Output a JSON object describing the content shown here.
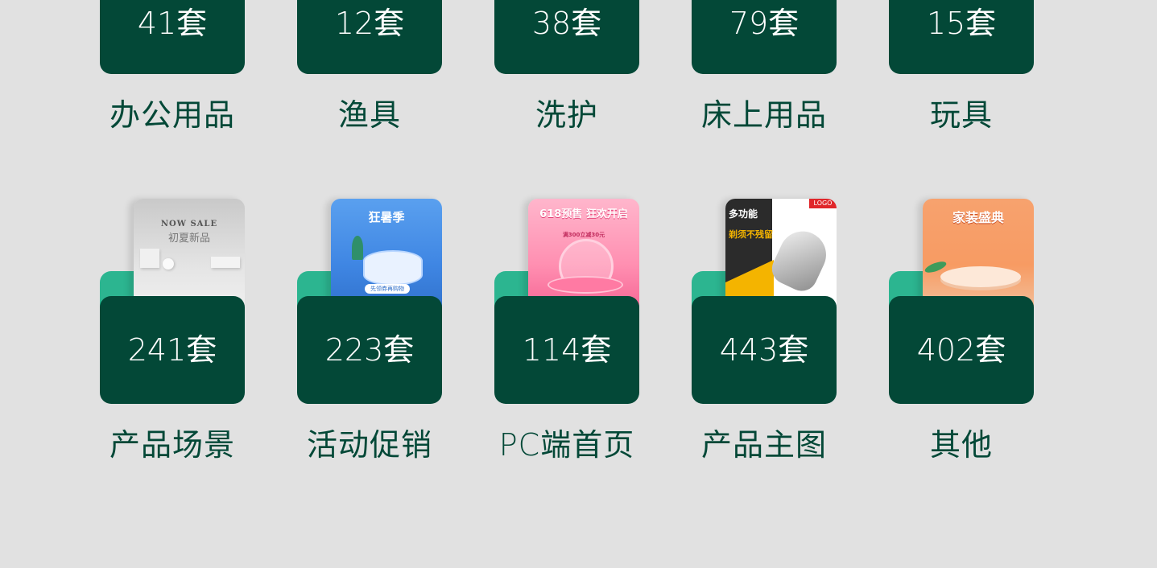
{
  "top_row": [
    {
      "count": "41套",
      "label": "办公用品"
    },
    {
      "count": "12套",
      "label": "渔具"
    },
    {
      "count": "38套",
      "label": "洗护"
    },
    {
      "count": "79套",
      "label": "床上用品"
    },
    {
      "count": "15套",
      "label": "玩具"
    }
  ],
  "bottom_row": [
    {
      "count": "241套",
      "label": "产品场景",
      "thumb": {
        "line1": "NOW SALE",
        "line2": "初夏新品"
      }
    },
    {
      "count": "223套",
      "label": "活动促销",
      "thumb": {
        "line1": "狂暑季",
        "line2": "先领券再购物"
      }
    },
    {
      "count": "114套",
      "label": "PC端首页",
      "thumb": {
        "line1": "618预售 狂欢开启",
        "line2": "满300立减30元"
      }
    },
    {
      "count": "443套",
      "label": "产品主图",
      "thumb": {
        "line1": "多功能",
        "line2": "剃须不残留",
        "logo": "LOGO"
      }
    },
    {
      "count": "402套",
      "label": "其他",
      "thumb": {
        "line1": "家装盛典"
      }
    }
  ],
  "colors": {
    "background": "#e1e1e1",
    "card": "#034837",
    "tab": "#2cb590",
    "label": "#034837"
  }
}
